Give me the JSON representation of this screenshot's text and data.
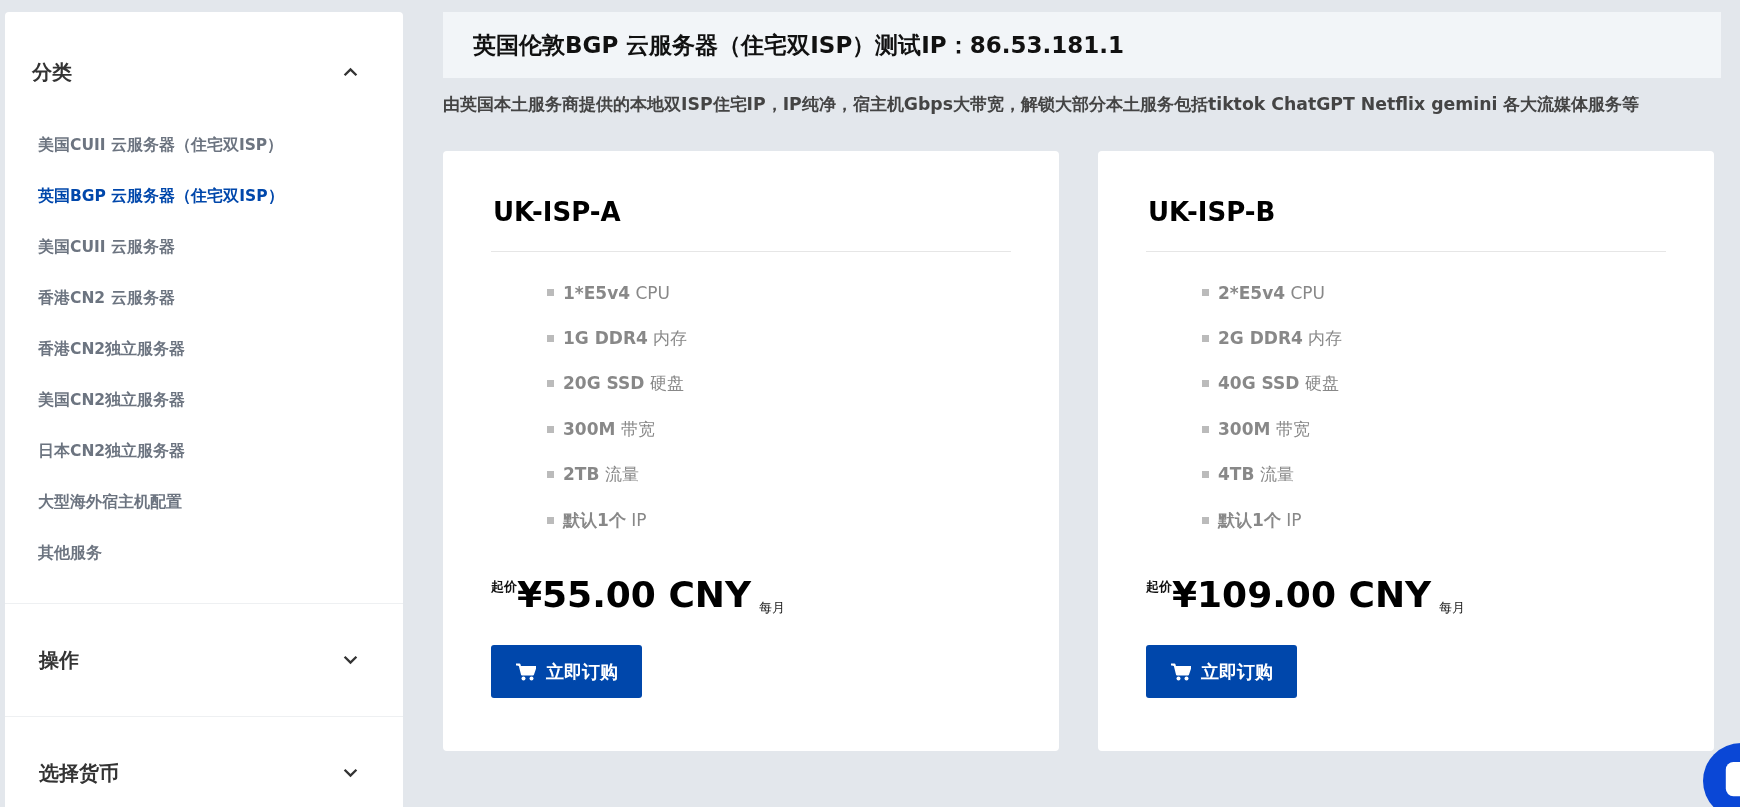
{
  "sidebar": {
    "sections": [
      {
        "title": "分类",
        "expanded": true,
        "items": [
          {
            "label": "美国CUII 云服务器（住宅双ISP）",
            "selected": false
          },
          {
            "label": "英国BGP 云服务器（住宅双ISP）",
            "selected": true
          },
          {
            "label": "美国CUII 云服务器",
            "selected": false
          },
          {
            "label": "香港CN2 云服务器",
            "selected": false
          },
          {
            "label": "香港CN2独立服务器",
            "selected": false
          },
          {
            "label": "美国CN2独立服务器",
            "selected": false
          },
          {
            "label": "日本CN2独立服务器",
            "selected": false
          },
          {
            "label": "大型海外宿主机配置",
            "selected": false
          },
          {
            "label": "其他服务",
            "selected": false
          }
        ]
      },
      {
        "title": "操作",
        "expanded": false
      },
      {
        "title": "选择货币",
        "expanded": false
      }
    ]
  },
  "header": {
    "title": "英国伦敦BGP 云服务器（住宅双ISP）测试IP：86.53.181.1",
    "description": "由英国本土服务商提供的本地双ISP住宅IP，IP纯净，宿主机Gbps大带宽，解锁大部分本土服务包括tiktok ChatGPT Netflix gemini 各大流媒体服务等"
  },
  "products": [
    {
      "name": "UK-ISP-A",
      "features": [
        {
          "value": "1*E5v4",
          "unit": "CPU"
        },
        {
          "value": "1G DDR4",
          "unit": "内存"
        },
        {
          "value": "20G SSD",
          "unit": "硬盘"
        },
        {
          "value": "300M",
          "unit": "带宽"
        },
        {
          "value": "2TB",
          "unit": "流量"
        },
        {
          "value": "默认1个",
          "unit": "IP"
        }
      ],
      "price_prefix": "起价",
      "price": "¥55.00 CNY",
      "period": "每月",
      "button": "立即订购"
    },
    {
      "name": "UK-ISP-B",
      "features": [
        {
          "value": "2*E5v4",
          "unit": "CPU"
        },
        {
          "value": "2G DDR4",
          "unit": "内存"
        },
        {
          "value": "40G SSD",
          "unit": "硬盘"
        },
        {
          "value": "300M",
          "unit": "带宽"
        },
        {
          "value": "4TB",
          "unit": "流量"
        },
        {
          "value": "默认1个",
          "unit": "IP"
        }
      ],
      "price_prefix": "起价",
      "price": "¥109.00 CNY",
      "period": "每月",
      "button": "立即订购"
    }
  ]
}
